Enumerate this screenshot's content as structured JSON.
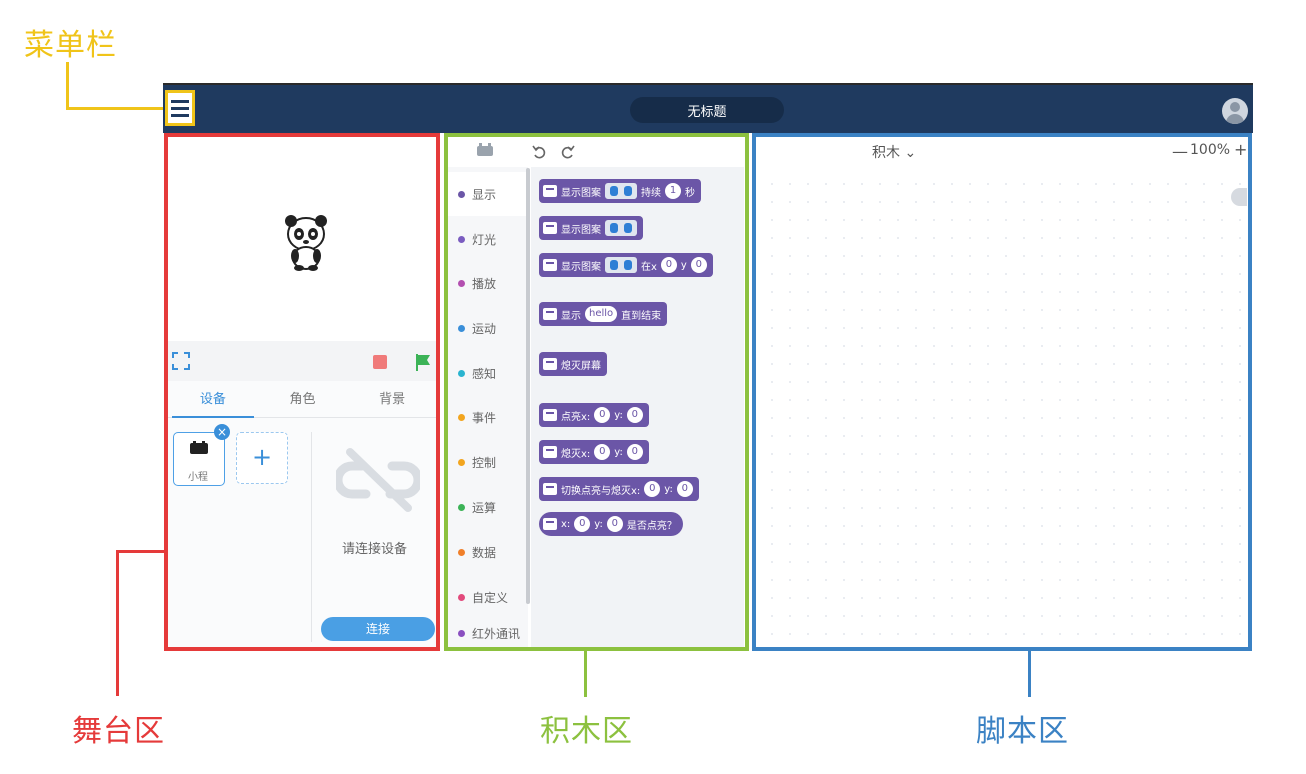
{
  "annotations": {
    "menu_bar": "菜单栏",
    "stage_area": "舞台区",
    "blocks_area": "积木区",
    "script_area": "脚本区",
    "colors": {
      "menu_bar": "#f0c419",
      "stage_area": "#e53a3a",
      "blocks_area": "#8cc13f",
      "script_area": "#3b82c4"
    }
  },
  "topbar": {
    "title": "无标题",
    "menu_icon": "hamburger-icon",
    "avatar_icon": "user-avatar-icon",
    "color": "#1f3a5f"
  },
  "stage": {
    "tabs": [
      "设备",
      "角色",
      "背景"
    ],
    "device_name": "小程",
    "add_icon": "+",
    "close_icon": "×",
    "no_connection_text": "请连接设备",
    "connect_button": "连接"
  },
  "blocks": {
    "categories": [
      {
        "label": "显示",
        "color": "#6b56a7"
      },
      {
        "label": "灯光",
        "color": "#7a5cc0"
      },
      {
        "label": "播放",
        "color": "#b34fb0"
      },
      {
        "label": "运动",
        "color": "#3a8fd9"
      },
      {
        "label": "感知",
        "color": "#2ab4d0"
      },
      {
        "label": "事件",
        "color": "#f2a51f"
      },
      {
        "label": "控制",
        "color": "#f2a51f"
      },
      {
        "label": "运算",
        "color": "#3cb357"
      },
      {
        "label": "数据",
        "color": "#f07f2a"
      },
      {
        "label": "自定义",
        "color": "#e24a7c"
      },
      {
        "label": "红外通讯",
        "color": "#8a4fc0"
      }
    ],
    "palette": {
      "b1": {
        "t1": "显示图案",
        "t2": "持续",
        "v1": "1",
        "t3": "秒"
      },
      "b2": {
        "t1": "显示图案"
      },
      "b3": {
        "t1": "显示图案",
        "t2": "在x",
        "v1": "0",
        "t3": "y",
        "v2": "0"
      },
      "b4": {
        "t1": "显示",
        "v1": "hello",
        "t2": "直到结束"
      },
      "b5": {
        "t1": "熄灭屏幕"
      },
      "b6": {
        "t1": "点亮x:",
        "v1": "0",
        "t2": "y:",
        "v2": "0"
      },
      "b7": {
        "t1": "熄灭x:",
        "v1": "0",
        "t2": "y:",
        "v2": "0"
      },
      "b8": {
        "t1": "切换点亮与熄灭x:",
        "v1": "0",
        "t2": "y:",
        "v2": "0"
      },
      "b9": {
        "t1": "x:",
        "v1": "0",
        "t2": "y:",
        "v2": "0",
        "t3": "是否点亮？"
      }
    },
    "block_color": "#6b56a7"
  },
  "script": {
    "mode": "积木 ⌄",
    "zoom_out": "—",
    "zoom": "100%",
    "zoom_in": "+"
  }
}
